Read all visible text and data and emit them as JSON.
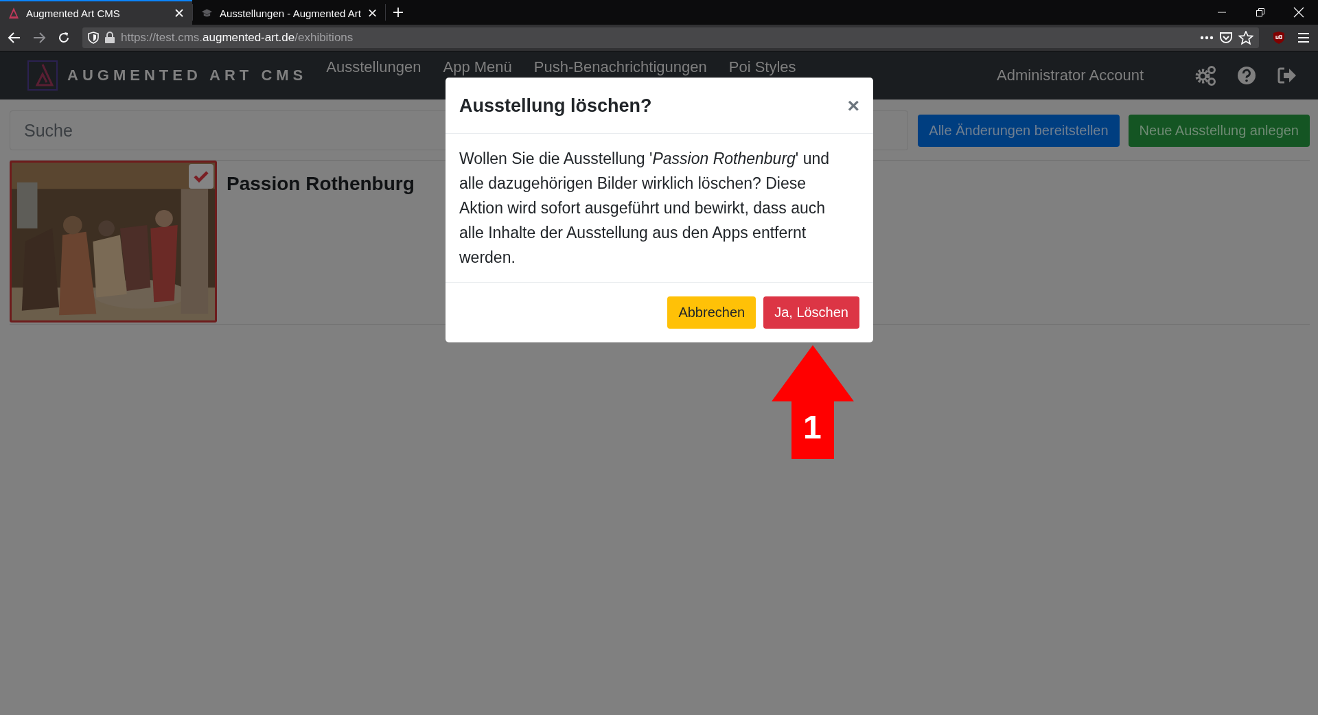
{
  "browser": {
    "tabs": [
      {
        "title": "Augmented Art CMS",
        "selected": true
      },
      {
        "title": "Ausstellungen - Augmented Art",
        "selected": false
      }
    ],
    "address": {
      "prefix": "https://test.cms.",
      "domain": "augmented-art.de",
      "path": "/exhibitions"
    }
  },
  "navbar": {
    "brand": "AUGMENTED ART CMS",
    "links": [
      "Ausstellungen",
      "App Menü",
      "Push-Benachrichtigungen",
      "Poi Styles"
    ],
    "account": "Administrator Account"
  },
  "search": {
    "placeholder": "Suche"
  },
  "actions": [
    {
      "label": "Alle Änderungen bereitstellen",
      "kind": "primary"
    },
    {
      "label": "Neue Ausstellung anlegen",
      "kind": "success"
    }
  ],
  "exhibitions": [
    {
      "title": "Passion Rothenburg",
      "checked": true
    }
  ],
  "dialog": {
    "title": "Ausstellung löschen?",
    "close": "×",
    "message": "Wollen Sie die Ausstellung '*Passion Rothenburg*' und alle dazugehörigen Bilder wirklich löschen? Diese Aktion wird sofort ausgeführt und bewirkt, dass auch alle Inhalte der Ausstellung aus den Apps entfernt werden.",
    "buttons": [
      {
        "label": "Abbrechen",
        "kind": "warning"
      },
      {
        "label": "Ja, Löschen",
        "kind": "danger"
      }
    ]
  },
  "annotation": {
    "label": "1"
  }
}
